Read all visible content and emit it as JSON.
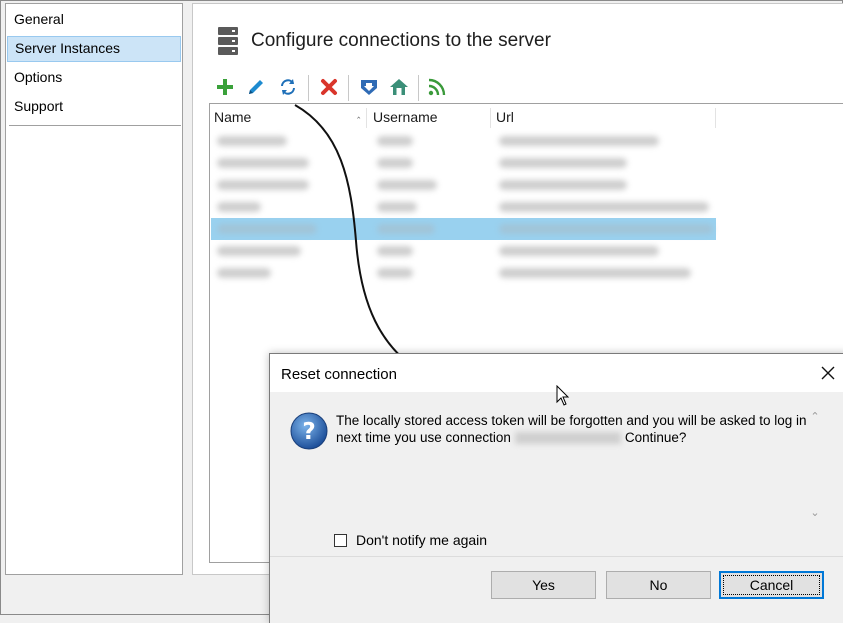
{
  "nav": {
    "items": [
      {
        "label": "General"
      },
      {
        "label": "Server Instances"
      },
      {
        "label": "Options"
      },
      {
        "label": "Support"
      }
    ],
    "selected_index": 1
  },
  "main": {
    "title": "Configure connections to the server",
    "title_icon": "server-stack-icon",
    "toolbar": [
      {
        "name": "add-icon",
        "color": "#3aa13a"
      },
      {
        "name": "edit-pencil-icon",
        "color": "#1e8bd0"
      },
      {
        "name": "refresh-icon",
        "color": "#1e6fb8"
      },
      {
        "name": "delete-x-icon",
        "color": "#d9352b"
      },
      {
        "name": "download-shield-icon",
        "color": "#2f6bb5"
      },
      {
        "name": "home-icon",
        "color": "#3b8f78"
      },
      {
        "name": "rss-feed-icon",
        "color": "#3a9a3a"
      }
    ],
    "list": {
      "columns": [
        {
          "label": "Name"
        },
        {
          "label": "Username"
        },
        {
          "label": "Url"
        }
      ],
      "row_count": 7,
      "selected_row": 4
    }
  },
  "dialog": {
    "title": "Reset connection",
    "message_part1": "The locally stored access token will be forgotten and you will be asked to log in next time you use connection",
    "message_part2": "Continue?",
    "checkbox_label": "Don't notify me again",
    "checkbox_checked": false,
    "buttons": {
      "yes": "Yes",
      "no": "No",
      "cancel": "Cancel"
    },
    "default_button": "cancel",
    "accent_color": "#0078d7"
  }
}
